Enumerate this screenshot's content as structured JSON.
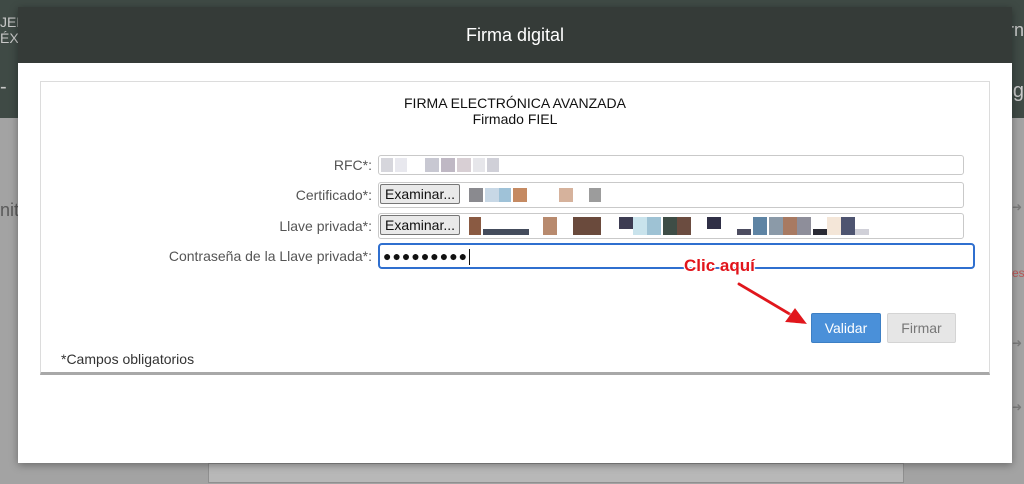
{
  "background": {
    "left_top_text": "JER\nÉX",
    "left_dash": "-",
    "left_word": "nit",
    "right_top_text": "rn",
    "right_letter": "g",
    "right_close_icon": "close-icon",
    "right_side_text": "es"
  },
  "modal": {
    "title": "Firma digital",
    "panel_title": "FIRMA ELECTRÓNICA AVANZADA",
    "panel_subtitle": "Firmado FIEL",
    "rfc": {
      "label": "RFC*:",
      "value": ""
    },
    "certificado": {
      "label": "Certificado*:",
      "button": "Examinar...",
      "file": ""
    },
    "llave_privada": {
      "label": "Llave privada*:",
      "button": "Examinar...",
      "file": ""
    },
    "contrasena": {
      "label": "Contraseña de la Llave privada*:",
      "value": "●●●●●●●●●"
    },
    "validar_button": "Validar",
    "firmar_button": "Firmar",
    "required_note": "*Campos obligatorios"
  },
  "annotation": {
    "text": "Clic aquí",
    "color": "#e1141b",
    "icon": "red-arrow-icon"
  },
  "colors": {
    "header_bg": "#353b38",
    "validar_bg": "#4a90d9",
    "focus_border": "#2f6fcf"
  }
}
